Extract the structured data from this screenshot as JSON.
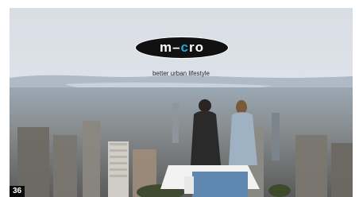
{
  "brand": {
    "logo_text": "m-cro",
    "logo_prefix": "m–",
    "logo_o": "c",
    "logo_suffix": "ro",
    "tagline": "better urban lifestyle"
  },
  "overlay": {
    "counter": "36"
  },
  "colors": {
    "logo_bg": "#111111",
    "logo_accent": "#1ea6d8",
    "sky": "#dfe3ea",
    "haze": "#b9c6d2"
  }
}
